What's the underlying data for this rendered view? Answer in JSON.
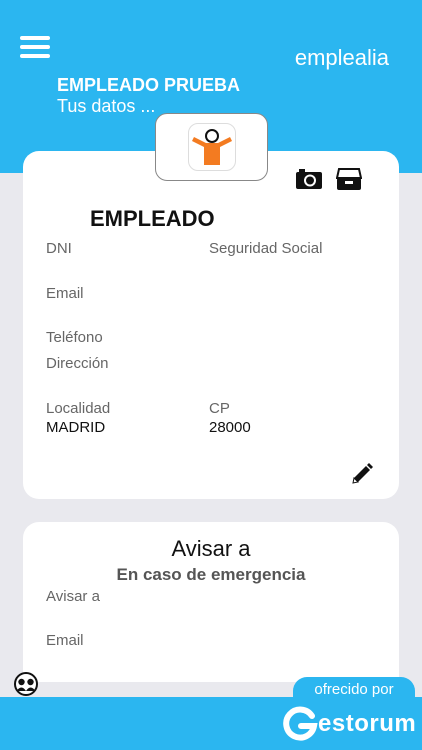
{
  "header": {
    "brand": "emplealia",
    "user_name": "EMPLEADO PRUEBA",
    "subtitle": "Tus datos ..."
  },
  "employee_card": {
    "title": "EMPLEADO",
    "fields": {
      "dni_label": "DNI",
      "ss_label": "Seguridad Social",
      "email_label": "Email",
      "phone_label": "Teléfono",
      "address_label": "Dirección",
      "city_label": "Localidad",
      "city_value": "MADRID",
      "cp_label": "CP",
      "cp_value": "28000"
    },
    "icons": [
      "camera-icon",
      "archive-icon",
      "pencil-icon"
    ]
  },
  "emergency_card": {
    "title": "Avisar a",
    "subtitle": "En caso de emergencia",
    "contact_label": "Avisar a",
    "email_label": "Email"
  },
  "footer": {
    "offered_by": "ofrecido por",
    "logo_text": "estorum",
    "logo_letter": "G"
  },
  "colors": {
    "accent": "#2bb6f0",
    "logo_orange": "#f37b21"
  }
}
